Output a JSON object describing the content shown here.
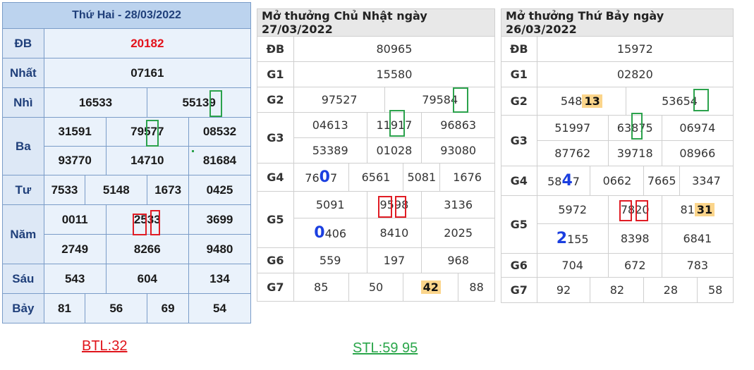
{
  "t1": {
    "title": "Thứ Hai - 28/03/2022",
    "rows": {
      "db_label": "ĐB",
      "db": "20182",
      "g1_label": "Nhất",
      "g1": "07161",
      "g2_label": "Nhì",
      "g2": [
        "16533",
        "55139"
      ],
      "g3_label": "Ba",
      "g3": [
        "31591",
        "79577",
        "08532",
        "93770",
        "14710",
        "81684"
      ],
      "g4_label": "Tư",
      "g4": [
        "7533",
        "5148",
        "1673",
        "0425"
      ],
      "g5_label": "Năm",
      "g5": [
        "0011",
        "2533",
        "3699",
        "2749",
        "8266",
        "9480"
      ],
      "g6_label": "Sáu",
      "g6": [
        "543",
        "604",
        "134"
      ],
      "g7_label": "Bảy",
      "g7": [
        "81",
        "56",
        "69",
        "54"
      ]
    }
  },
  "t2": {
    "title": "Mở thưởng Chủ Nhật ngày 27/03/2022",
    "labels": [
      "ĐB",
      "G1",
      "G2",
      "G3",
      "G4",
      "G5",
      "G6",
      "G7"
    ],
    "db": "80965",
    "g1": "15580",
    "g2": [
      "97527",
      "79584"
    ],
    "g3": [
      "04613",
      "11917",
      "96863",
      "53389",
      "01028",
      "93080"
    ],
    "g4": [
      {
        "pre": "76",
        "big": "0",
        "post": "7"
      },
      "6561",
      "5081",
      "1676"
    ],
    "g5": [
      "5091",
      "9598",
      "3136",
      {
        "big": "0",
        "post": "406"
      },
      "8410",
      "2025"
    ],
    "g6": [
      "559",
      "197",
      "968"
    ],
    "g7": [
      "85",
      "50",
      "42",
      "88"
    ]
  },
  "t3": {
    "title": "Mở thưởng Thứ Bảy ngày 26/03/2022",
    "labels": [
      "ĐB",
      "G1",
      "G2",
      "G3",
      "G4",
      "G5",
      "G6",
      "G7"
    ],
    "db": "15972",
    "g1": "02820",
    "g2": [
      {
        "pre": "548",
        "hl": "13"
      },
      "53654"
    ],
    "g3": [
      "51997",
      "63875",
      "06974",
      "87762",
      "39718",
      "08966"
    ],
    "g4": [
      {
        "pre": "58",
        "big": "4",
        "post": "7"
      },
      "0662",
      "7665",
      "3347"
    ],
    "g5": [
      "5972",
      "7820",
      {
        "pre": "81",
        "hl": "31"
      },
      {
        "big": "2",
        "post": "155"
      },
      "8398",
      "6841"
    ],
    "g6": [
      "704",
      "672",
      "783"
    ],
    "g7": [
      "92",
      "82",
      "28",
      "58"
    ]
  },
  "notes": {
    "btl": "BTL:32",
    "stl": "STL:59 95"
  },
  "colors": {
    "highlight": "#fbd58b",
    "green_mark": "#2ba24c",
    "red_mark": "#e01c24",
    "blue_digit": "#1b3fe0"
  }
}
